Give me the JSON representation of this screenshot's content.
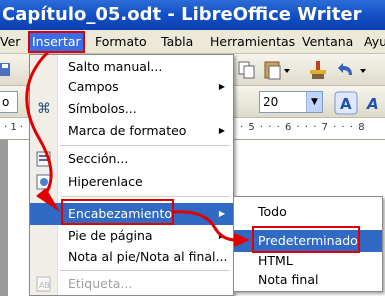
{
  "window": {
    "title": "Capítulo_05.odt - LibreOffice Writer"
  },
  "menubar": {
    "items": [
      "Ver",
      "Insertar",
      "Formato",
      "Tabla",
      "Herramientas",
      "Ventana",
      "Ayu"
    ]
  },
  "toolbar": {
    "font_size": "20"
  },
  "ruler": {
    "marks": "· 5 · · · 6 · · · 7 · · · 8"
  },
  "insert_menu": {
    "items": [
      {
        "label": "Salto manual..."
      },
      {
        "label": "Campos"
      },
      {
        "label": "Símbolos..."
      },
      {
        "label": "Marca de formateo"
      },
      {
        "label": "Sección..."
      },
      {
        "label": "Hiperenlace"
      },
      {
        "label": "Encabezamiento"
      },
      {
        "label": "Pie de página"
      },
      {
        "label": "Nota al pie/Nota al final..."
      },
      {
        "label": "Etiqueta..."
      }
    ]
  },
  "header_submenu": {
    "items": [
      "Todo",
      "Predeterminado",
      "HTML",
      "Nota final"
    ]
  },
  "colors": {
    "highlight": "#316ac5",
    "annotation": "#e00000",
    "titlebar": "#1552c8"
  }
}
